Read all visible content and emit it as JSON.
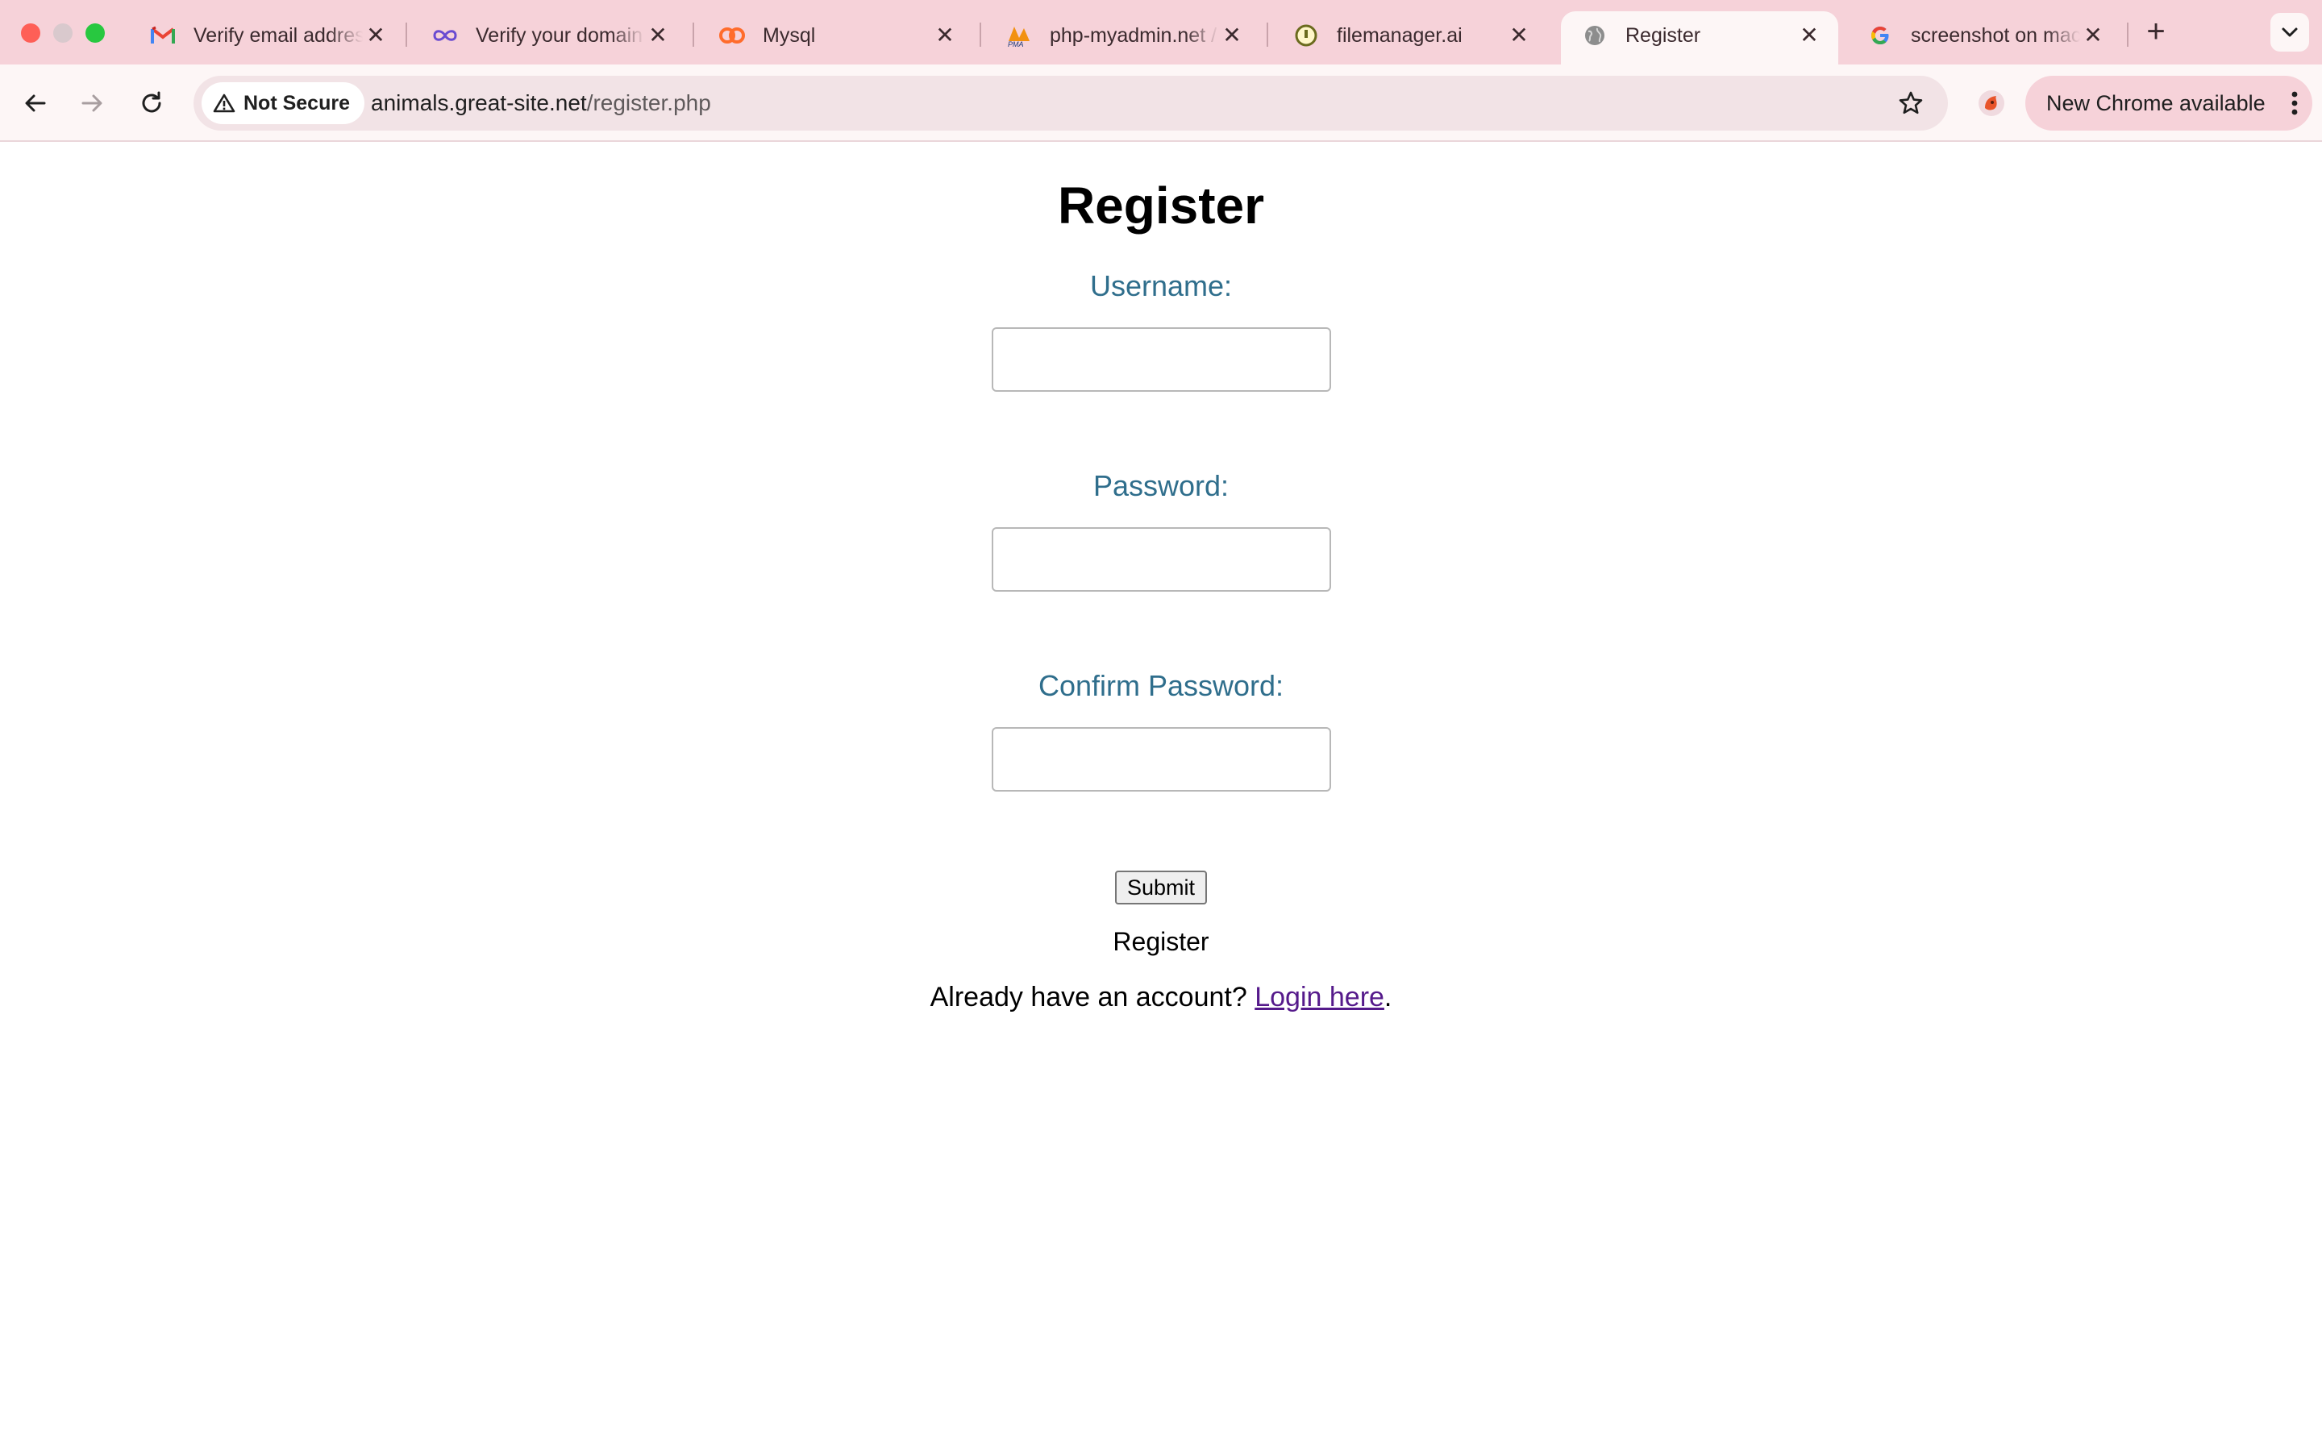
{
  "browser": {
    "tabs": [
      {
        "title": "Verify email address",
        "icon": "gmail-icon",
        "active": false
      },
      {
        "title": "Verify your domain",
        "icon": "infinity-icon",
        "active": false
      },
      {
        "title": "Mysql",
        "icon": "cpanel-icon",
        "active": false
      },
      {
        "title": "php-myadmin.net / ...",
        "icon": "phpmyadmin-icon",
        "active": false
      },
      {
        "title": "filemanager.ai",
        "icon": "filemanager-icon",
        "active": false
      },
      {
        "title": "Register",
        "icon": "globe-icon",
        "active": true
      },
      {
        "title": "screenshot on mac",
        "icon": "google-icon",
        "active": false
      }
    ],
    "tab_close_glyph": "✕",
    "new_tab_glyph": "+",
    "address_bar": {
      "security_label": "Not Secure",
      "url_host": "animals.great-site.net",
      "url_path": "/register.php"
    },
    "update_chip_label": "New Chrome available",
    "colors": {
      "tabstrip_bg": "#f6d2d9",
      "toolbar_bg": "#fdf6f6",
      "omnibox_bg": "#f2e3e6"
    }
  },
  "page": {
    "title": "Register",
    "fields": [
      {
        "label": "Username:",
        "value": ""
      },
      {
        "label": "Password:",
        "value": ""
      },
      {
        "label": "Confirm Password:",
        "value": ""
      }
    ],
    "submit_label": "Submit",
    "register_text": "Register",
    "login_prompt": "Already have an account?",
    "login_link": "Login here",
    "login_suffix": ".",
    "colors": {
      "label_color": "#2f6e8c",
      "link_color": "#551a8b"
    }
  }
}
